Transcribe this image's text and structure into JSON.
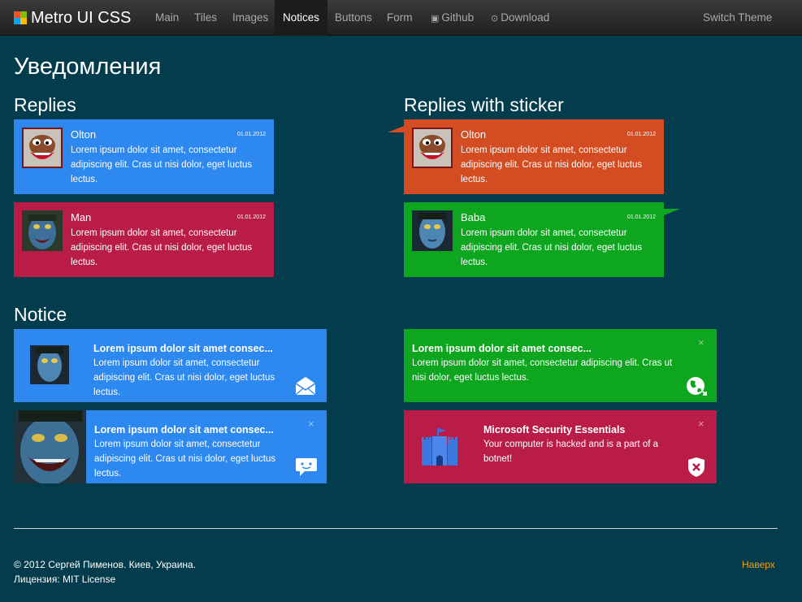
{
  "nav": {
    "brand": "Metro UI CSS",
    "items": [
      {
        "label": "Main"
      },
      {
        "label": "Tiles"
      },
      {
        "label": "Images"
      },
      {
        "label": "Notices"
      },
      {
        "label": "Buttons"
      },
      {
        "label": "Form"
      },
      {
        "label": "Github",
        "icon": "github-icon"
      },
      {
        "label": "Download",
        "icon": "download-icon"
      }
    ],
    "active": "Notices",
    "switch_theme": "Switch Theme"
  },
  "page_title": "Уведомления",
  "replies": {
    "title": "Replies",
    "items": [
      {
        "author": "Olton",
        "date": "01.01.2012",
        "text": "Lorem ipsum dolor sit amet, consectetur adipiscing elit. Cras ut nisi dolor, eget luctus lectus.",
        "color": "#2d89ef",
        "avatar": "taz-avatar"
      },
      {
        "author": "Man",
        "date": "01.01.2012",
        "text": "Lorem ipsum dolor sit amet, consectetur adipiscing elit. Cras ut nisi dolor, eget luctus lectus.",
        "color": "#b91d47",
        "avatar": "navi-avatar"
      }
    ]
  },
  "replies_sticker": {
    "title": "Replies with sticker",
    "items": [
      {
        "author": "Olton",
        "date": "01.01.2012",
        "text": "Lorem ipsum dolor sit amet, consectetur adipiscing elit. Cras ut nisi dolor, eget luctus lectus.",
        "color": "#d34c22",
        "avatar": "taz-avatar",
        "sticker": "left"
      },
      {
        "author": "Baba",
        "date": "01.01.2012",
        "text": "Lorem ipsum dolor sit amet, consectetur adipiscing elit. Cras ut nisi dolor, eget luctus lectus.",
        "color": "#0ea51f",
        "avatar": "navi-avatar",
        "sticker": "right"
      }
    ]
  },
  "notice": {
    "title": "Notice",
    "items": [
      {
        "title": "Lorem ipsum dolor sit amet consec...",
        "text": "Lorem ipsum dolor sit amet, consectetur adipiscing elit. Cras ut nisi dolor, eget luctus lectus.",
        "color": "#2d89ef",
        "icon": "mail-icon"
      },
      {
        "title": "Lorem ipsum dolor sit amet consec...",
        "text": "Lorem ipsum dolor sit amet, consectetur adipiscing elit. Cras ut nisi dolor, eget luctus lectus.",
        "color": "#0ea51f",
        "icon": "globe-icon",
        "close": "×"
      },
      {
        "title": "Lorem ipsum dolor sit amet consec...",
        "text": "Lorem ipsum dolor sit amet, consectetur adipiscing elit. Cras ut nisi dolor, eget luctus lectus.",
        "color": "#2d89ef",
        "icon": "chat-icon",
        "close": "×"
      },
      {
        "title": "Microsoft Security Essentials",
        "text": "Your computer is hacked and is a part of a botnet!",
        "color": "#b91d47",
        "icon": "shield-icon",
        "close": "×"
      }
    ]
  },
  "footer": {
    "copyright": "© 2012 Сергей Пименов. Киев, Украина.",
    "license": "Лицензия: MIT License",
    "top_link": "Наверх"
  }
}
